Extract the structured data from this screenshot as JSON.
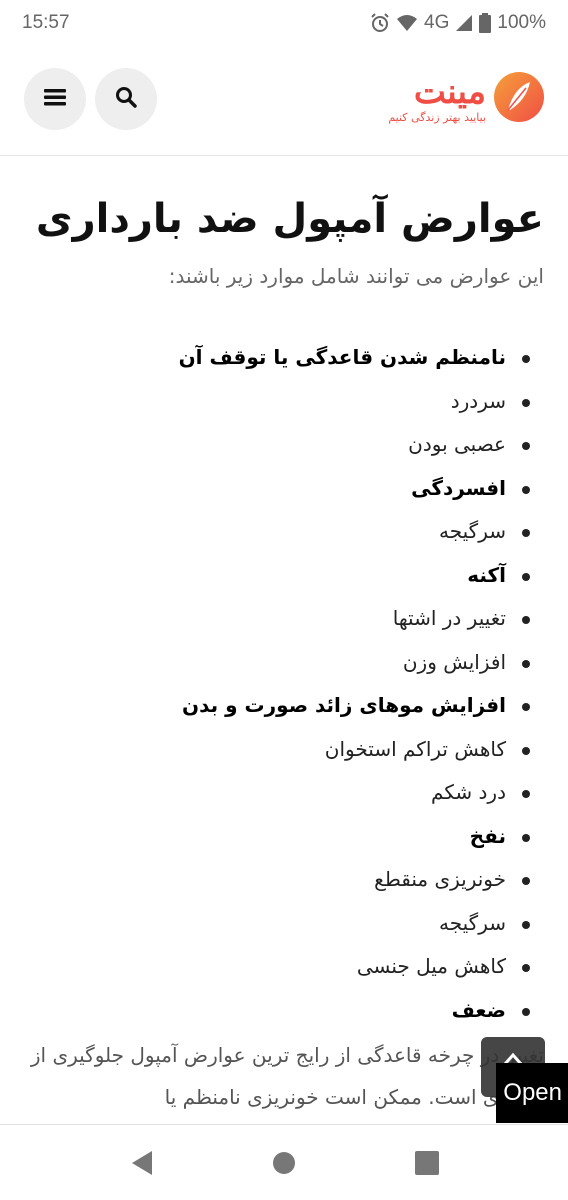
{
  "status_bar": {
    "time": "15:57",
    "network": "4G",
    "battery": "100%"
  },
  "header": {
    "logo_title": "مینت",
    "logo_tagline": "بیایید بهتر زندگی کنیم"
  },
  "article": {
    "title": "عوارض آمپول ضد بارداری",
    "intro": "این عوارض می توانند شامل موارد زیر باشند:",
    "effects": [
      {
        "text": "نامنظم شدن قاعدگی یا توقف آن",
        "bold": true
      },
      {
        "text": "سردرد",
        "bold": false
      },
      {
        "text": "عصبی بودن",
        "bold": false
      },
      {
        "text": "افسردگی",
        "bold": true
      },
      {
        "text": "سرگیجه",
        "bold": false
      },
      {
        "text": "آکنه",
        "bold": true
      },
      {
        "text": "تغییر در اشتها",
        "bold": false
      },
      {
        "text": "افزایش وزن",
        "bold": false
      },
      {
        "text": "افزایش موهای زائد صورت و بدن",
        "bold": true
      },
      {
        "text": "کاهش تراکم استخوان",
        "bold": false
      },
      {
        "text": "درد شکم",
        "bold": false
      },
      {
        "text": "نفخ",
        "bold": true
      },
      {
        "text": "خونریزی منقطع",
        "bold": false
      },
      {
        "text": "سرگیجه",
        "bold": false
      },
      {
        "text": "کاهش میل جنسی",
        "bold": false
      },
      {
        "text": "ضعف",
        "bold": true
      }
    ],
    "paragraph": "تغییر در چرخه قاعدگی از رایج ترین عوارض آمپول جلوگیری از بارداری است. ممکن است خونریزی نامنظم یا"
  },
  "open_badge": "Open",
  "colors": {
    "brand": "#f04e45",
    "brand_secondary": "#f5a03a"
  }
}
